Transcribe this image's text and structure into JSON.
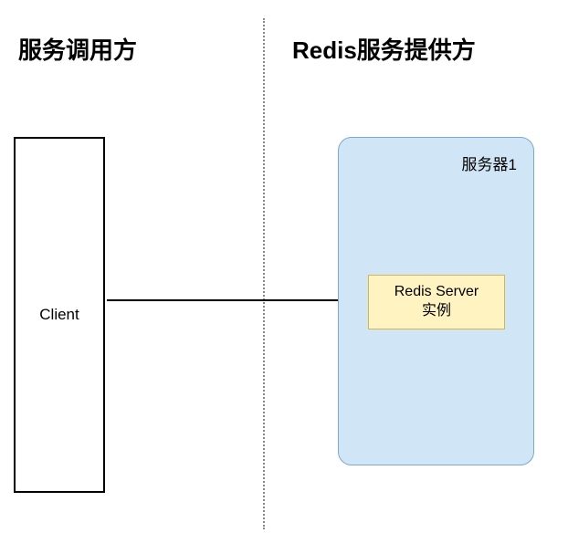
{
  "headers": {
    "left": "服务调用方",
    "right": "Redis服务提供方"
  },
  "client": {
    "label": "Client"
  },
  "server": {
    "container_label": "服务器1",
    "instance_label_line1": "Redis Server",
    "instance_label_line2": "实例"
  }
}
